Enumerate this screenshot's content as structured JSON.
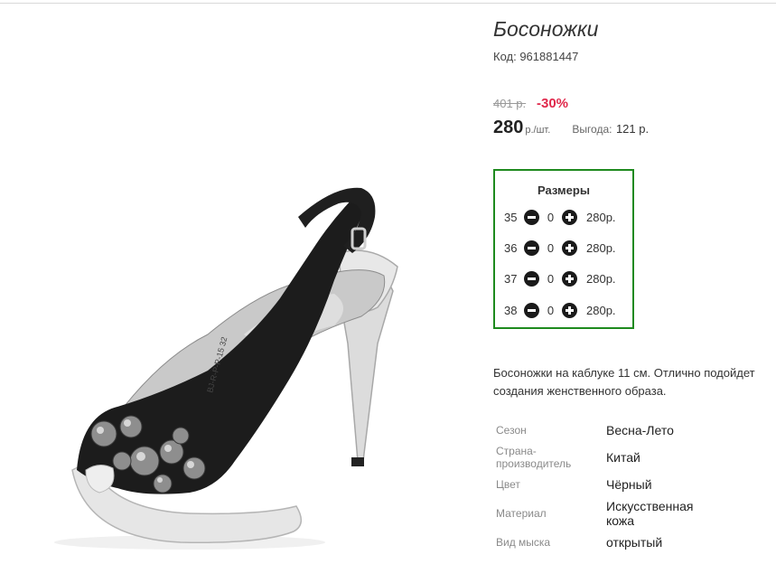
{
  "product": {
    "title": "Босоножки",
    "code_label": "Код: 961881447",
    "old_price": "401 р.",
    "discount": "-30%",
    "price": "280",
    "price_unit": "р./шт.",
    "saving_label": "Выгода:",
    "saving_value": "121 р.",
    "description_line1": "Босоножки на каблуке 11 см. Отлично подойдет",
    "description_line2": "создания женственного образа."
  },
  "sizes": {
    "title": "Размеры",
    "rows": [
      {
        "size": "35",
        "qty": "0",
        "price": "280р."
      },
      {
        "size": "36",
        "qty": "0",
        "price": "280р."
      },
      {
        "size": "37",
        "qty": "0",
        "price": "280р."
      },
      {
        "size": "38",
        "qty": "0",
        "price": "280р."
      }
    ]
  },
  "specs": [
    {
      "label": "Сезон",
      "value": "Весна-Лето"
    },
    {
      "label_line1": "Страна-",
      "label_line2": "производитель",
      "value": "Китай"
    },
    {
      "label": "Цвет",
      "value": "Чёрный"
    },
    {
      "label": "Материал",
      "value_line1": "Искусственная",
      "value_line2": "кожа"
    },
    {
      "label": "Вид мыска",
      "value": "открытый"
    }
  ],
  "image": {
    "icon": "sandal-product-photo",
    "insole_marking": "BJ-R-P-P-15 32",
    "colors": {
      "upper": "#1c1c1c",
      "sole": "#e6e6e6",
      "heel": "#dcdcdc",
      "insole": "#c9c9c9",
      "accent": "#1e8a1e",
      "discount": "#e0284b"
    }
  }
}
